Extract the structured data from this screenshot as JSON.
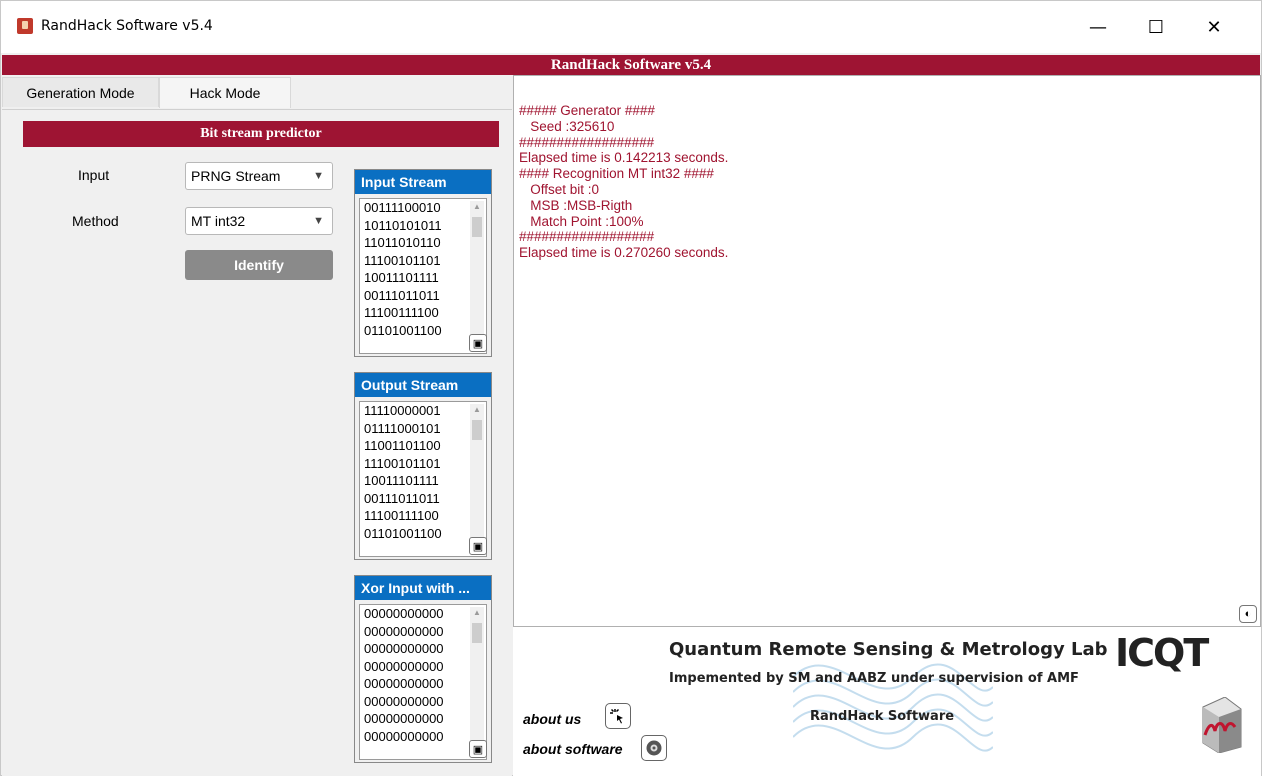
{
  "window": {
    "title": "RandHack Software v5.4",
    "minimize": "—",
    "maximize": "☐",
    "close": "✕"
  },
  "banner": "RandHack Software v5.4",
  "tabs": [
    {
      "label": "Generation Mode",
      "active": false
    },
    {
      "label": "Hack Mode",
      "active": true
    }
  ],
  "predictor": {
    "title": "Bit stream predictor",
    "input_label": "Input",
    "input_value": "PRNG Stream",
    "method_label": "Method",
    "method_value": "MT int32",
    "identify_label": "Identify"
  },
  "streams": {
    "input": {
      "title": "Input Stream",
      "lines": [
        "00111100010",
        "10110101011",
        "11011010110",
        "11100101101",
        "10011101111",
        "00111011011",
        "11100111100",
        "01101001100"
      ]
    },
    "output": {
      "title": "Output Stream",
      "lines": [
        "11110000001",
        "01111000101",
        "11001101100",
        "11100101101",
        "10011101111",
        "00111011011",
        "11100111100",
        "01101001100"
      ]
    },
    "xor": {
      "title": "Xor Input with ...",
      "lines": [
        "00000000000",
        "00000000000",
        "00000000000",
        "00000000000",
        "00000000000",
        "00000000000",
        "00000000000",
        "00000000000"
      ]
    }
  },
  "log": [
    "##### Generator ####",
    "   Seed :325610",
    "##################",
    "Elapsed time is 0.142213 seconds.",
    "#### Recognition MT int32 ####",
    "   Offset bit :0",
    "   MSB :MSB-Rigth",
    "   Match Point :100%",
    "##################",
    "Elapsed time is 0.270260 seconds."
  ],
  "footer": {
    "lab_title": "Quantum Remote Sensing & Metrology Lab",
    "logo_text": "ICQT",
    "subtitle": "Impemented by SM and AABZ under supervision of AMF",
    "software_name": "RandHack Software",
    "about_us": "about us",
    "about_software": "about software"
  },
  "colors": {
    "accent_red": "#9e1433",
    "stream_header_blue": "#0a6fc2",
    "log_text": "#a01430"
  },
  "icons": {
    "app": "randhack-app-icon",
    "save": "save-icon",
    "clear": "clear-icon",
    "about_us": "cursor-click-icon",
    "about_software": "disc-icon"
  }
}
